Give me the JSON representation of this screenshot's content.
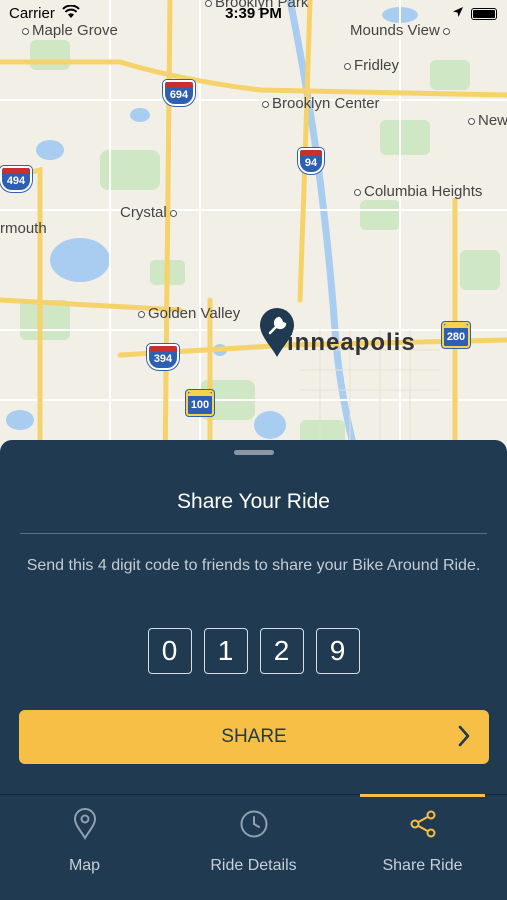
{
  "status_bar": {
    "carrier": "Carrier",
    "time": "3:39 PM"
  },
  "map": {
    "labels": {
      "brooklyn_park": "Brooklyn Park",
      "maple_grove": "Maple Grove",
      "mounds_view": "Mounds View",
      "fridley": "Fridley",
      "brooklyn_center": "Brooklyn Center",
      "new": "New",
      "columbia_heights": "Columbia Heights",
      "crystal": "Crystal",
      "plymouth": "rmouth",
      "golden_valley": "Golden Valley",
      "minneapolis": "inneapolis"
    },
    "shields": {
      "i694": "694",
      "i94": "94",
      "i494": "494",
      "i394": "394",
      "us100": "100",
      "us280": "280"
    },
    "pin_icon": "wrench-icon"
  },
  "sheet": {
    "title": "Share Your Ride",
    "description": "Send this 4 digit code to friends to share your Bike Around Ride.",
    "code": [
      "0",
      "1",
      "2",
      "9"
    ],
    "share_label": "SHARE"
  },
  "tabs": [
    {
      "label": "Map",
      "icon": "map-pin-icon",
      "active": false
    },
    {
      "label": "Ride Details",
      "icon": "clock-icon",
      "active": false
    },
    {
      "label": "Share Ride",
      "icon": "share-icon",
      "active": true
    }
  ],
  "colors": {
    "navy": "#1f3a51",
    "accent": "#f7bf45",
    "map_bg": "#f2efe6"
  }
}
